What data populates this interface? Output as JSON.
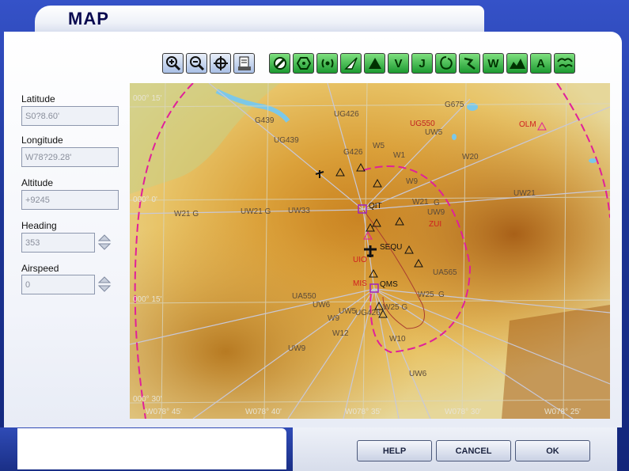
{
  "window": {
    "title": "MAP"
  },
  "toolbar": {
    "buttons": [
      {
        "name": "zoom-in",
        "glyph": ""
      },
      {
        "name": "zoom-out",
        "glyph": ""
      },
      {
        "name": "center-aircraft",
        "glyph": ""
      },
      {
        "name": "print",
        "glyph": ""
      },
      {
        "name": "airports",
        "glyph": ""
      },
      {
        "name": "vor",
        "glyph": ""
      },
      {
        "name": "ndb",
        "glyph": ""
      },
      {
        "name": "ils",
        "glyph": ""
      },
      {
        "name": "intersections",
        "glyph": ""
      },
      {
        "name": "victor-airways",
        "glyph": "V"
      },
      {
        "name": "jet-airways",
        "glyph": "J"
      },
      {
        "name": "airspace",
        "glyph": ""
      },
      {
        "name": "flight-path",
        "glyph": ""
      },
      {
        "name": "wind",
        "glyph": "W"
      },
      {
        "name": "terrain",
        "glyph": ""
      },
      {
        "name": "altitude-labels",
        "glyph": "A"
      },
      {
        "name": "weather",
        "glyph": ""
      }
    ]
  },
  "fields": {
    "latitude": {
      "label": "Latitude",
      "value": "S0?8.60'"
    },
    "longitude": {
      "label": "Longitude",
      "value": "W78?29.28'"
    },
    "altitude": {
      "label": "Altitude",
      "value": "+9245"
    },
    "heading": {
      "label": "Heading",
      "value": "353"
    },
    "airspeed": {
      "label": "Airspeed",
      "value": "0"
    }
  },
  "map": {
    "grid_labels": [
      "000° 15'",
      "000° 0'",
      "000° 15'",
      "000° 30'",
      "W078° 45'",
      "W078° 40'",
      "W078° 35'",
      "W078° 30'",
      "W078° 25'"
    ],
    "airways": [
      "G439",
      "UG426",
      "UG439",
      "G675",
      "UG550",
      "UW5",
      "W5",
      "W1",
      "W20",
      "W9",
      "W21",
      "G",
      "W21 G",
      "UW21 G",
      "UW9",
      "UW21",
      "UW33",
      "UA550",
      "UW6",
      "UW5",
      "UG426",
      "UW9",
      "W25",
      "G",
      "W25 G",
      "W10",
      "W12",
      "W9",
      "UA565",
      "UW6",
      "G426",
      "G675"
    ],
    "navaids": [
      {
        "id": "QIT",
        "type": "vor"
      },
      {
        "id": "SEQU",
        "type": "airport"
      },
      {
        "id": "QMS",
        "type": "vor"
      },
      {
        "id": "OLM",
        "type": "ndb"
      },
      {
        "id": "ZUI",
        "type": "ndb"
      },
      {
        "id": "UIO",
        "type": "ndb"
      },
      {
        "id": "MIS",
        "type": "ndb"
      }
    ],
    "colors": {
      "airspace_boundary": "#e0209a",
      "vor": "#a020c0",
      "ndb_label": "#d02020",
      "water": "#7cc8e8"
    }
  },
  "buttons": {
    "help": "HELP",
    "cancel": "CANCEL",
    "ok": "OK"
  }
}
